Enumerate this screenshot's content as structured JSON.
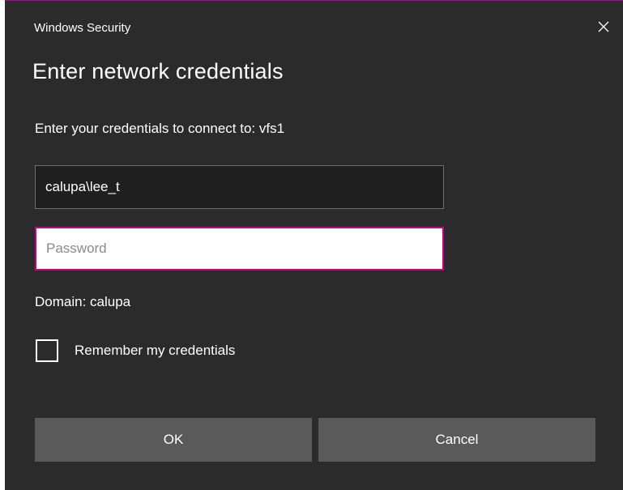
{
  "window": {
    "title": "Windows Security",
    "close_icon": "close-icon"
  },
  "dialog": {
    "heading": "Enter network credentials",
    "subtext": "Enter your credentials to connect to: vfs1",
    "username_value": "calupa\\lee_t",
    "password_value": "",
    "password_placeholder": "Password",
    "domain_text": "Domain: calupa",
    "remember_label": "Remember my credentials",
    "remember_checked": false
  },
  "buttons": {
    "ok_label": "OK",
    "cancel_label": "Cancel"
  },
  "colors": {
    "background": "#2b2b2b",
    "accent": "#c4008b",
    "button": "#5a5a5a",
    "text": "#ffffff"
  }
}
